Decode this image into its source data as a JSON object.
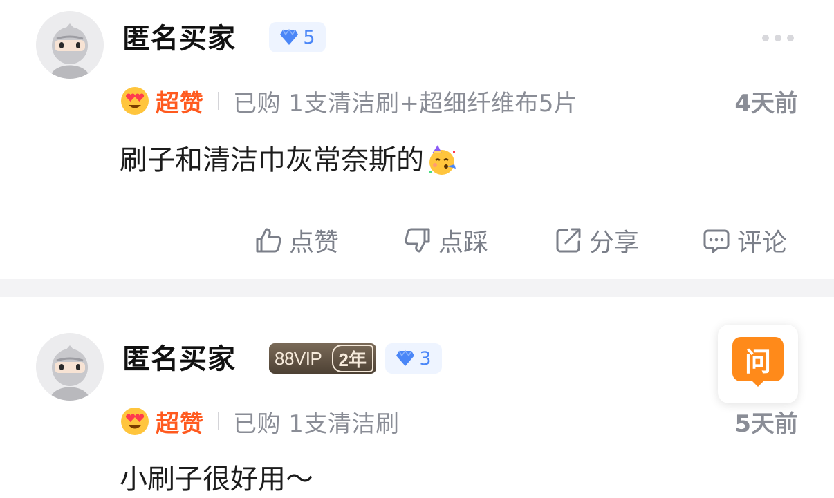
{
  "reviews": [
    {
      "username": "匿名买家",
      "level": "5",
      "rating": "超赞",
      "purchase": "已购 1支清洁刷+超细纤维布5片",
      "time": "4天前",
      "content": "刷子和清洁巾灰常奈斯的",
      "content_emoji": "partying-face-icon"
    },
    {
      "username": "匿名买家",
      "vip_label": "88VIP",
      "vip_years": "2年",
      "level": "3",
      "rating": "超赞",
      "purchase": "已购 1支清洁刷",
      "time": "5天前",
      "content": "小刷子很好用～"
    }
  ],
  "actions": {
    "like": "点赞",
    "dislike": "点踩",
    "share": "分享",
    "comment": "评论"
  },
  "ask_button": "问",
  "colors": {
    "rating": "#ff5a1f",
    "level_badge": "#4a86f7",
    "ask": "#ff8a1a",
    "muted": "#8a8d96"
  }
}
